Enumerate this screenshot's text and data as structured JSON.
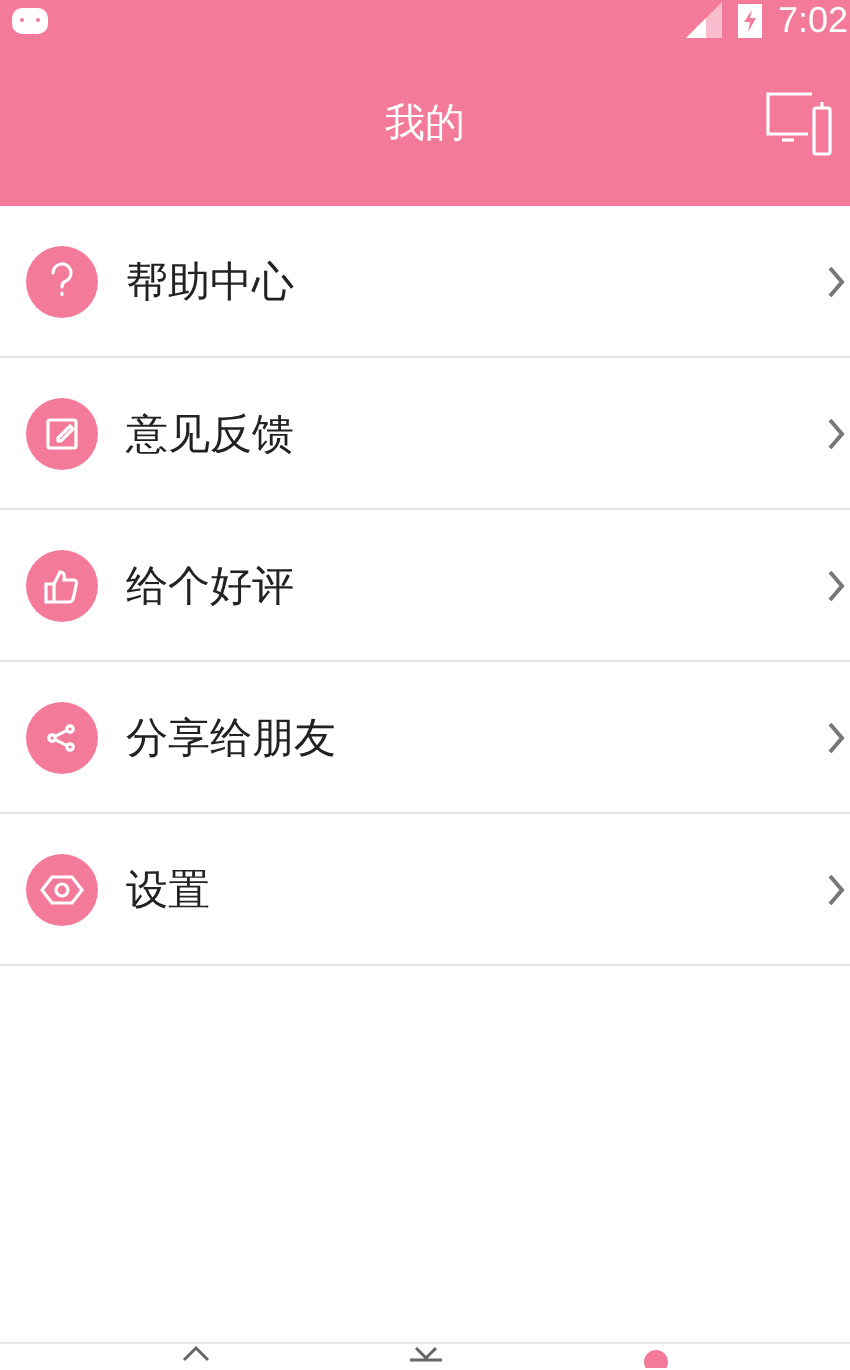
{
  "status_bar": {
    "time": "7:02"
  },
  "header": {
    "title": "我的"
  },
  "menu": [
    {
      "kind": "help",
      "label": "帮助中心"
    },
    {
      "kind": "feedback",
      "label": "意见反馈"
    },
    {
      "kind": "rate",
      "label": "给个好评"
    },
    {
      "kind": "share",
      "label": "分享给朋友"
    },
    {
      "kind": "settings",
      "label": "设置"
    }
  ],
  "bottom_nav": [
    {
      "kind": "home",
      "selected": false
    },
    {
      "kind": "discover",
      "selected": false
    },
    {
      "kind": "mine",
      "selected": true
    }
  ]
}
